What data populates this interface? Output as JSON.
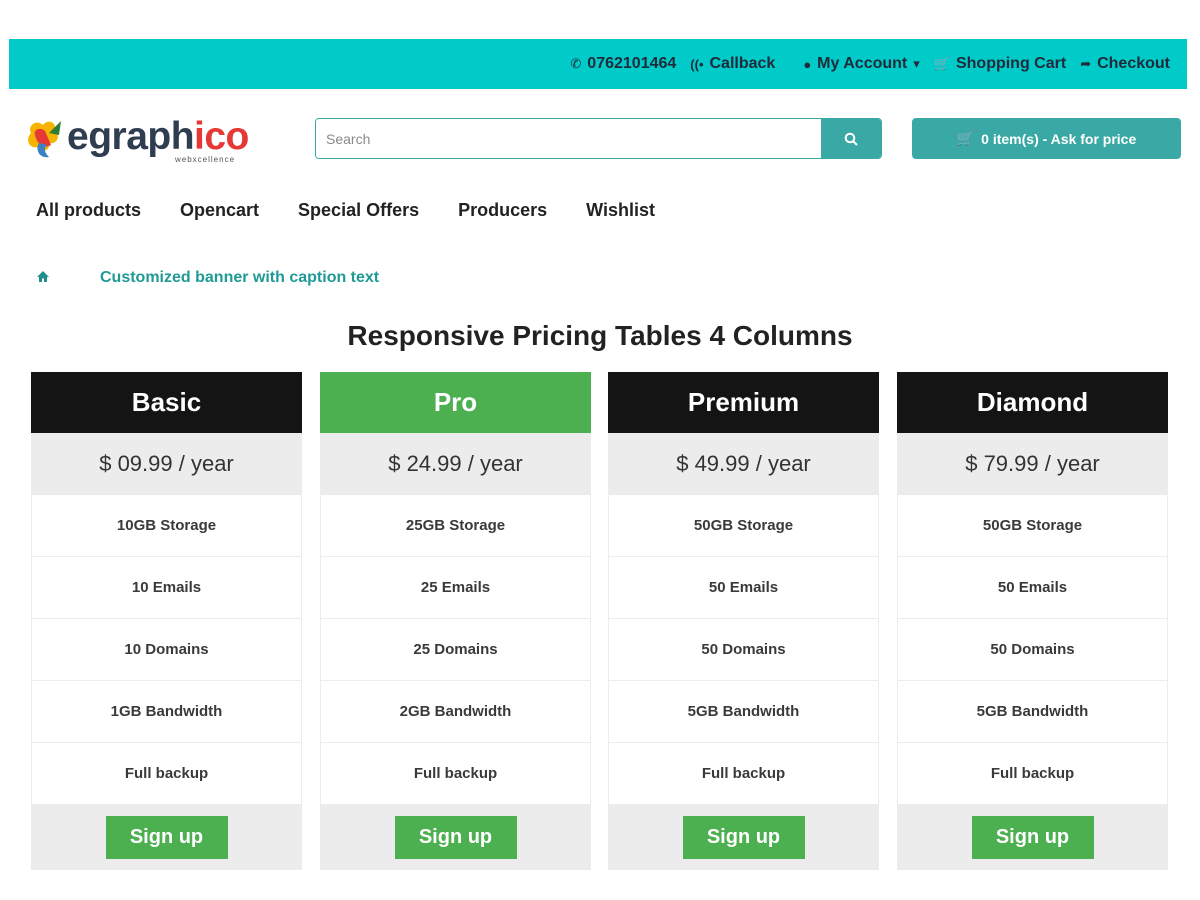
{
  "topbar": {
    "phone": "0762101464",
    "callback": "Callback",
    "my_account": "My Account",
    "account_caret": "▾",
    "shopping_cart": "Shopping Cart",
    "checkout": "Checkout",
    "background": "#00cbc8"
  },
  "header": {
    "logo_main": "egraph",
    "logo_accent": "ico",
    "logo_sub": "webxcellence",
    "search_placeholder": "Search",
    "cart_label": "0 item(s) - Ask for price"
  },
  "nav": {
    "items": [
      "All products",
      "Opencart",
      "Special Offers",
      "Producers",
      "Wishlist"
    ]
  },
  "breadcrumb": {
    "current": "Customized banner with caption text"
  },
  "page": {
    "title": "Responsive Pricing Tables 4 Columns"
  },
  "plans": [
    {
      "name": "Basic",
      "price": "$ 09.99 / year",
      "features": [
        "10GB Storage",
        "10 Emails",
        "10 Domains",
        "1GB Bandwidth",
        "Full backup"
      ],
      "button": "Sign up",
      "header_color": "#141414"
    },
    {
      "name": "Pro",
      "price": "$ 24.99 / year",
      "features": [
        "25GB Storage",
        "25 Emails",
        "25 Domains",
        "2GB Bandwidth",
        "Full backup"
      ],
      "button": "Sign up",
      "header_color": "#4caf50"
    },
    {
      "name": "Premium",
      "price": "$ 49.99 / year",
      "features": [
        "50GB Storage",
        "50 Emails",
        "50 Domains",
        "5GB Bandwidth",
        "Full backup"
      ],
      "button": "Sign up",
      "header_color": "#141414"
    },
    {
      "name": "Diamond",
      "price": "$ 79.99 / year",
      "features": [
        "50GB Storage",
        "50 Emails",
        "50 Domains",
        "5GB Bandwidth",
        "Full backup"
      ],
      "button": "Sign up",
      "header_color": "#141414"
    }
  ],
  "colors": {
    "accent": "#3aa9a5",
    "signup": "#4caf50",
    "breadcrumb_link": "#1f9a95"
  }
}
